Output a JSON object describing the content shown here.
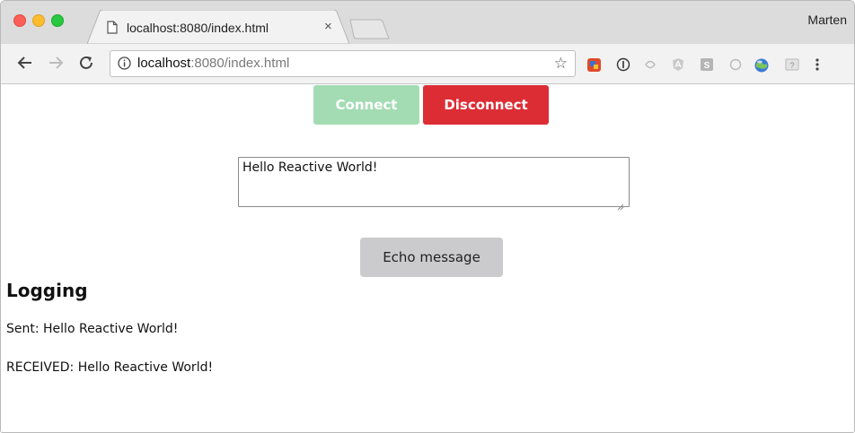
{
  "browser": {
    "tab": {
      "title": "localhost:8080/index.html",
      "close_glyph": "×"
    },
    "profile_name": "Marten",
    "address": {
      "host": "localhost",
      "rest": ":8080/index.html"
    },
    "icons": [
      "back-icon",
      "forward-icon",
      "reload-icon",
      "info-icon",
      "bookmark-star-icon",
      "page-icon",
      "new-tab-icon",
      "extension-icon",
      "menu-icon"
    ]
  },
  "page": {
    "connect_label": "Connect",
    "disconnect_label": "Disconnect",
    "message_value": "Hello Reactive World!",
    "echo_label": "Echo message",
    "logging_heading": "Logging",
    "log": [
      "Sent: Hello Reactive World!",
      "RECEIVED: Hello Reactive World!"
    ]
  },
  "colors": {
    "connect_bg": "#a3dcb3",
    "disconnect_bg": "#dc2d35",
    "echo_bg": "#cbcbcd"
  }
}
